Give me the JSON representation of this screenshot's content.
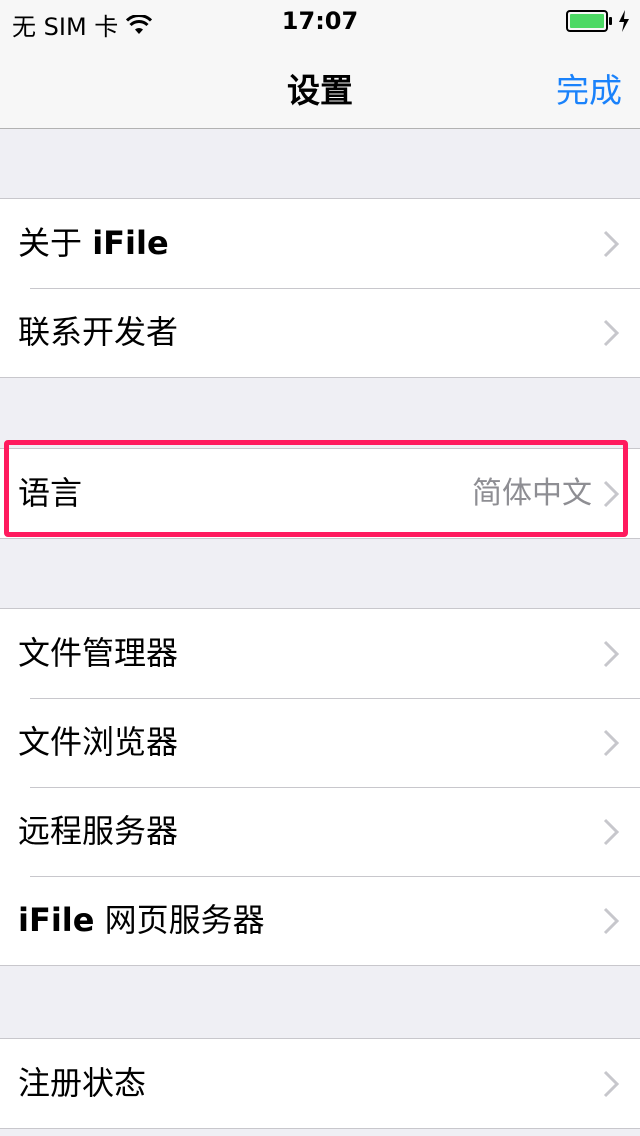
{
  "status_bar": {
    "carrier": "无 SIM 卡",
    "time": "17:07"
  },
  "nav": {
    "title": "设置",
    "done_label": "完成",
    "accent_color": "#1a82fb"
  },
  "groups": [
    {
      "rows": [
        {
          "label": "关于 iFile"
        },
        {
          "label": "联系开发者"
        }
      ]
    },
    {
      "rows": [
        {
          "label": "语言",
          "value": "简体中文"
        }
      ]
    },
    {
      "rows": [
        {
          "label": "文件管理器"
        },
        {
          "label": "文件浏览器"
        },
        {
          "label": "远程服务器"
        },
        {
          "label": "iFile 网页服务器"
        }
      ]
    },
    {
      "rows": [
        {
          "label": "注册状态"
        }
      ]
    }
  ],
  "highlight_color": "#ff1a5e"
}
